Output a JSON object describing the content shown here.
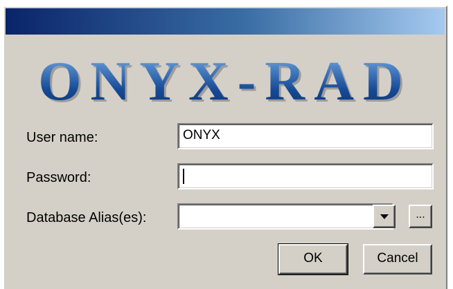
{
  "logo": {
    "text": "ONYX-RAD"
  },
  "form": {
    "username": {
      "label": "User name:",
      "value": "ONYX"
    },
    "password": {
      "label": "Password:",
      "value": ""
    },
    "alias": {
      "label": "Database Alias(es):",
      "value": "",
      "browse_label": "..."
    }
  },
  "buttons": {
    "ok": "OK",
    "cancel": "Cancel"
  },
  "colors": {
    "titlebar_start": "#0a246a",
    "titlebar_end": "#a6caf0",
    "logo_blue": "#164a96",
    "face": "#d4d0c8"
  }
}
